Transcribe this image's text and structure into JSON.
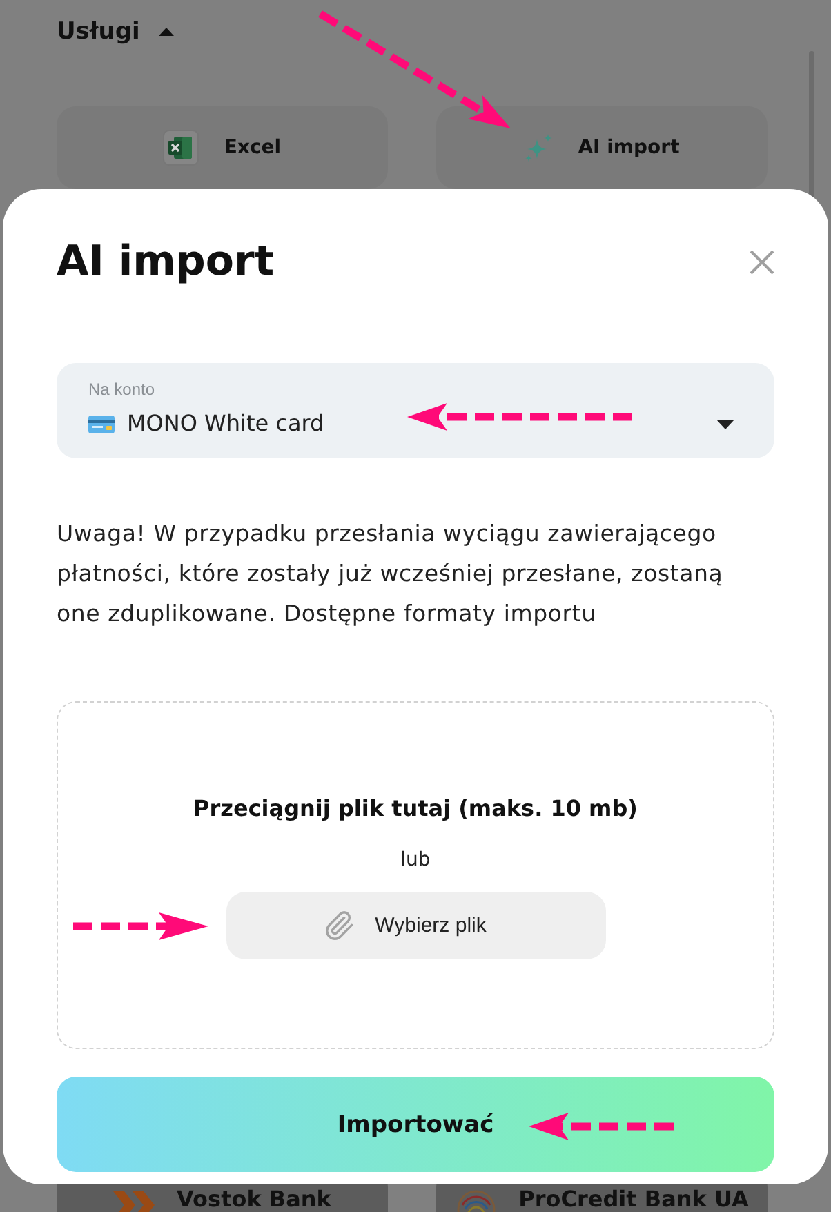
{
  "background_page": {
    "section": {
      "title": "Usługi",
      "expanded": true
    },
    "services": [
      {
        "kind": "excel",
        "label": "Excel"
      },
      {
        "kind": "ai",
        "label": "AI import"
      }
    ],
    "banks": [
      {
        "kind": "vostok",
        "label": "Vostok Bank"
      },
      {
        "kind": "procredit",
        "label": "ProCredit Bank UA"
      }
    ]
  },
  "dialog": {
    "title": "AI import",
    "account_field": {
      "label": "Na konto",
      "value": "MONO White card"
    },
    "notice": "Uwaga! W przypadku przesłania wyciągu zawierającego płatności, które zostały już wcześniej przesłane, zostaną one zduplikowane. Dostępne formaty importu",
    "dropzone": {
      "heading": "Przeciągnij plik tutaj (maks. 10 mb)",
      "separator": "lub",
      "button": "Wybierz plik"
    },
    "submit_button": "Importować"
  }
}
